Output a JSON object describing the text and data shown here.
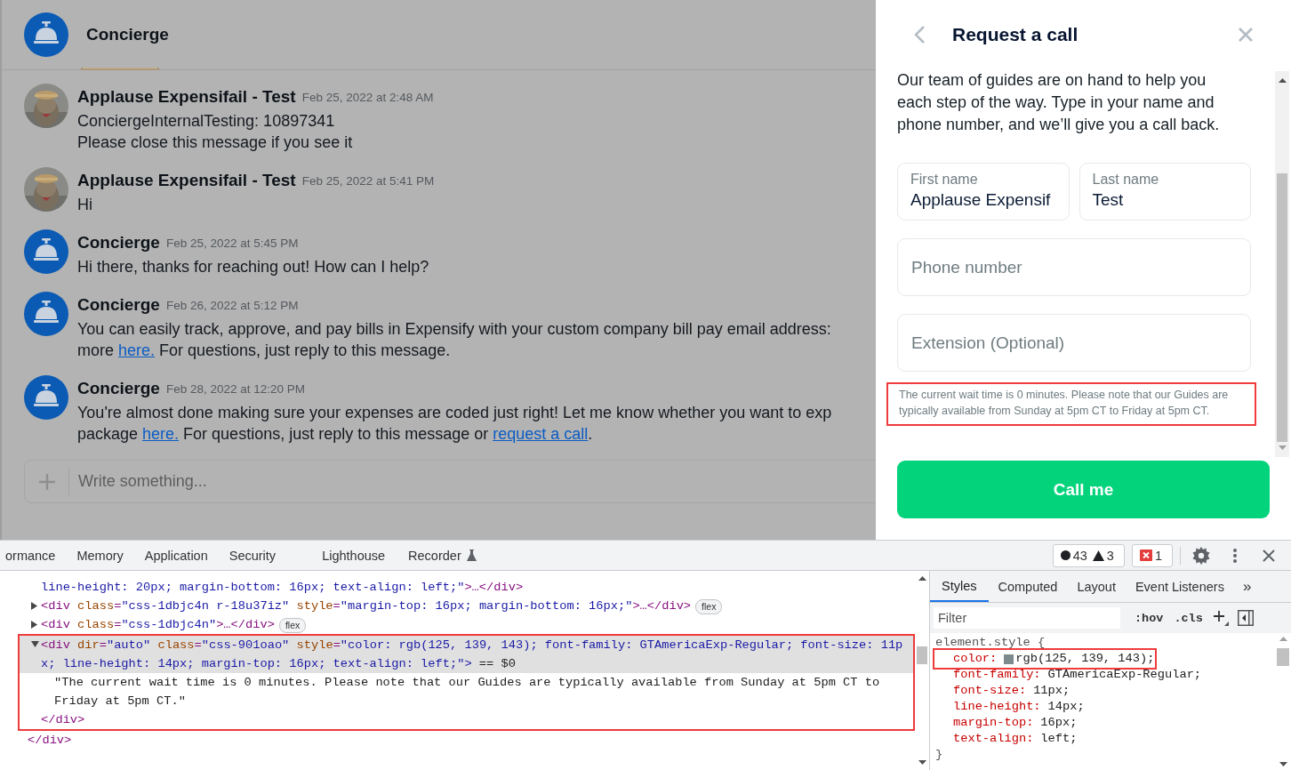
{
  "chat": {
    "header": {
      "title": "Concierge"
    },
    "messages": [
      {
        "kind": "user",
        "author": "Applause Expensifail - Test",
        "time": "Feb 25, 2022 at 2:48 AM",
        "lines": [
          [
            {
              "text": "ConciergeInternalTesting: 10897341",
              "link": false
            }
          ],
          [
            {
              "text": "Please close this message if you see it",
              "link": false
            }
          ]
        ]
      },
      {
        "kind": "user",
        "author": "Applause Expensifail - Test",
        "time": "Feb 25, 2022 at 5:41 PM",
        "lines": [
          [
            {
              "text": "Hi",
              "link": false
            }
          ]
        ]
      },
      {
        "kind": "concierge",
        "author": "Concierge",
        "time": "Feb 25, 2022 at 5:45 PM",
        "lines": [
          [
            {
              "text": "Hi there, thanks for reaching out! How can I help?",
              "link": false
            }
          ]
        ]
      },
      {
        "kind": "concierge",
        "author": "Concierge",
        "time": "Feb 26, 2022 at 5:12 PM",
        "lines": [
          [
            {
              "text": "You can easily track, approve, and pay bills in Expensify with your custom company bill pay email address:",
              "link": false
            }
          ],
          [
            {
              "text": "more ",
              "link": false
            },
            {
              "text": "here.",
              "link": true
            },
            {
              "text": " For questions, just reply to this message.",
              "link": false
            }
          ]
        ]
      },
      {
        "kind": "concierge",
        "author": "Concierge",
        "time": "Feb 28, 2022 at 12:20 PM",
        "lines": [
          [
            {
              "text": "You're almost done making sure your expenses are coded just right! Let me know whether you want to exp",
              "link": false
            }
          ],
          [
            {
              "text": "package ",
              "link": false
            },
            {
              "text": "here.",
              "link": true
            },
            {
              "text": " For questions, just reply to this message or ",
              "link": false
            },
            {
              "text": "request a call",
              "link": true
            },
            {
              "text": ".",
              "link": false
            }
          ]
        ]
      }
    ],
    "composer": {
      "placeholder": "Write something..."
    }
  },
  "call_panel": {
    "title": "Request a call",
    "intro": "Our team of guides are on hand to help you each step of the way. Type in your name and phone number, and we’ll give you a call back.",
    "field_rows": [
      [
        {
          "label": "First name",
          "value": "Applause Expensif"
        },
        {
          "label": "Last name",
          "value": "Test"
        }
      ],
      [
        {
          "placeholder": "Phone number"
        }
      ],
      [
        {
          "placeholder": "Extension (Optional)"
        }
      ]
    ],
    "wait_note": {
      "text": "The current wait time is 0 minutes.  Please note that our Guides are typically available from Sunday at 5pm CT to Friday at 5pm CT.",
      "highlighted": true
    },
    "submit": "Call me"
  },
  "devtools": {
    "tabs": [
      {
        "label": "ormance",
        "selected": false
      },
      {
        "label": "Memory",
        "selected": false
      },
      {
        "label": "Application",
        "selected": false
      },
      {
        "label": "Security",
        "selected": false
      },
      {
        "label": "Lighthouse",
        "selected": false
      },
      {
        "label": "Recorder",
        "selected": false
      }
    ],
    "counters": [
      {
        "kind": "dot",
        "count": "43"
      },
      {
        "kind": "warning",
        "count": "3"
      },
      {
        "kind": "error",
        "count": "1"
      }
    ],
    "dom_tree": {
      "close": "</div>",
      "children": [
        {
          "selected": false,
          "highlighted": false,
          "segments": [
            {
              "color": "#1a1aa6",
              "t": "line-height: 20px; margin-bottom: 16px; text-align: left;\""
            },
            {
              "color": "#881280",
              "t": ">…</div>"
            }
          ]
        },
        {
          "expanded": false,
          "selected": false,
          "highlighted": false,
          "badge": "flex",
          "segments": [
            {
              "color": "#881280",
              "t": "<div"
            },
            {
              "color": "#994500",
              "t": " class"
            },
            {
              "color": "#881280",
              "t": "="
            },
            {
              "color": "#1a1aa6",
              "t": "\"css-1dbjc4n r-18u37iz\""
            },
            {
              "color": "#994500",
              "t": " style"
            },
            {
              "color": "#881280",
              "t": "="
            },
            {
              "color": "#1a1aa6",
              "t": "\"margin-top: 16px; margin-bottom: 16px;\""
            },
            {
              "color": "#881280",
              "t": ">…</div>"
            }
          ]
        },
        {
          "expanded": false,
          "selected": false,
          "highlighted": false,
          "badge": "flex",
          "segments": [
            {
              "color": "#881280",
              "t": "<div"
            },
            {
              "color": "#994500",
              "t": " class"
            },
            {
              "color": "#881280",
              "t": "="
            },
            {
              "color": "#1a1aa6",
              "t": "\"css-1dbjc4n\""
            },
            {
              "color": "#881280",
              "t": ">…</div>"
            }
          ]
        },
        {
          "expanded": true,
          "selected": true,
          "highlighted": true,
          "segments": [
            {
              "color": "#881280",
              "t": "<div"
            },
            {
              "color": "#994500",
              "t": " dir"
            },
            {
              "color": "#881280",
              "t": "="
            },
            {
              "color": "#1a1aa6",
              "t": "\"auto\""
            },
            {
              "color": "#994500",
              "t": " class"
            },
            {
              "color": "#881280",
              "t": "="
            },
            {
              "color": "#1a1aa6",
              "t": "\"css-901oao\""
            },
            {
              "color": "#994500",
              "t": " style"
            },
            {
              "color": "#881280",
              "t": "="
            },
            {
              "color": "#1a1aa6",
              "t": "\"color: rgb(125, 139, 143); font-family: GTAmericaExp-Regular; font-size: 11px; line-height: 14px; margin-top: 16px; text-align: left;\">"
            },
            {
              "color": "#222222",
              "t": " == $0"
            }
          ],
          "children": [
            {
              "selected": false,
              "highlighted": true,
              "segments": [
                {
                  "color": "#222222",
                  "t": "\"The current wait time is 0 minutes. Please note that our Guides are typically available from Sunday at 5pm CT to Friday at 5pm CT.\""
                }
              ]
            }
          ],
          "close": "</div>"
        }
      ]
    },
    "side_tabs": [
      {
        "label": "Styles",
        "selected": true
      },
      {
        "label": "Computed",
        "selected": false
      },
      {
        "label": "Layout",
        "selected": false
      },
      {
        "label": "Event Listeners",
        "selected": false
      }
    ],
    "more_tabs": "»",
    "filter": {
      "placeholder": "Filter"
    },
    "filter_buttons": [
      ":hov",
      ".cls"
    ],
    "rule": {
      "selector": "element.style {",
      "close": "}",
      "declarations": [
        {
          "property": "color:",
          "value": "rgb(125, 139, 143);",
          "color": "#7d8b8f",
          "highlighted": true
        },
        {
          "property": "font-family:",
          "value": "GTAmericaExp-Regular;",
          "highlighted": false
        },
        {
          "property": "font-size:",
          "value": "11px;",
          "highlighted": false
        },
        {
          "property": "line-height:",
          "value": "14px;",
          "highlighted": false
        },
        {
          "property": "margin-top:",
          "value": "16px;",
          "highlighted": false
        },
        {
          "property": "text-align:",
          "value": "left;",
          "highlighted": false
        }
      ]
    }
  }
}
